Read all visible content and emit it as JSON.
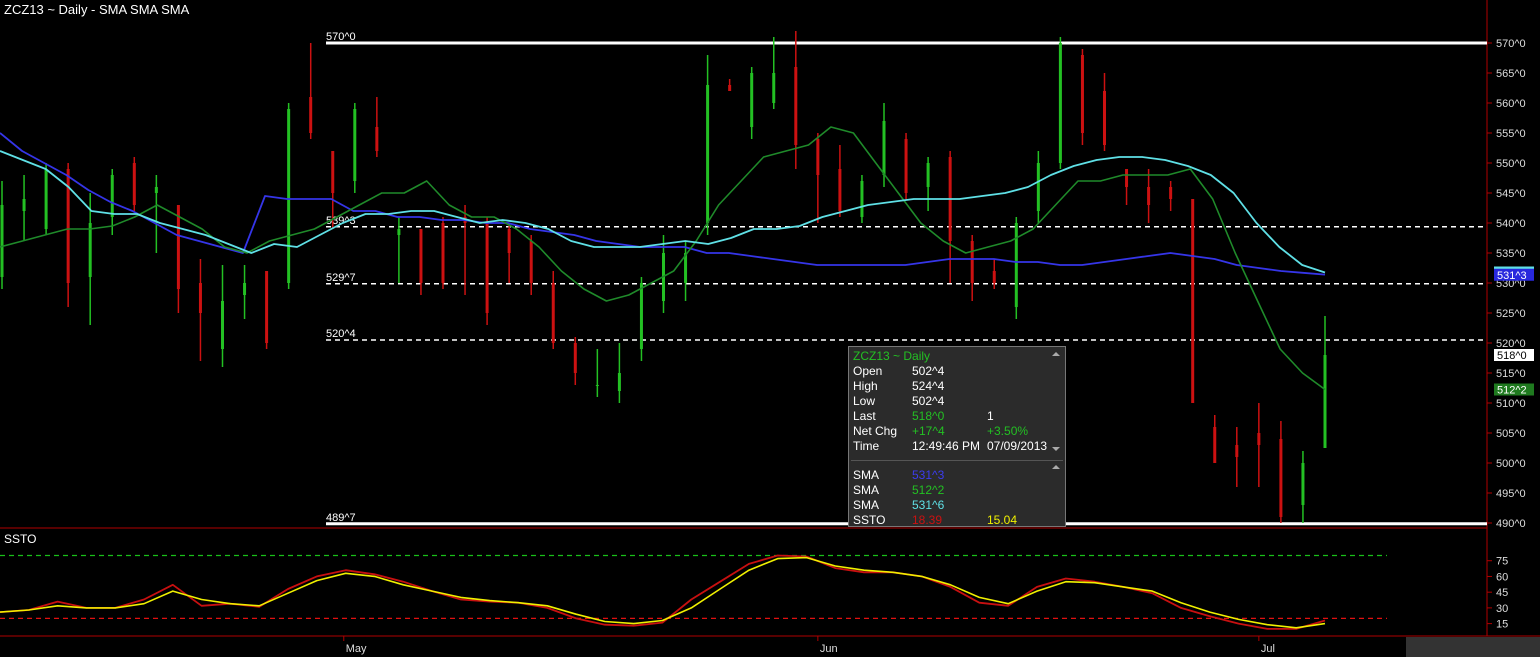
{
  "header": {
    "title": "ZCZ13 ~ Daily  -  SMA SMA SMA"
  },
  "indicator": {
    "title": "SSTO"
  },
  "levels": [
    {
      "label": "570^0",
      "value": 570.0,
      "style": "solid"
    },
    {
      "label": "539^3",
      "value": 539.375,
      "style": "dashed"
    },
    {
      "label": "529^7",
      "value": 529.875,
      "style": "dashed"
    },
    {
      "label": "520^4",
      "value": 520.5,
      "style": "dashed"
    },
    {
      "label": "489^7",
      "value": 489.875,
      "style": "solid"
    }
  ],
  "price_axis": {
    "ticks": [
      {
        "value": 570,
        "label": "570^0"
      },
      {
        "value": 565,
        "label": "565^0"
      },
      {
        "value": 560,
        "label": "560^0"
      },
      {
        "value": 555,
        "label": "555^0"
      },
      {
        "value": 550,
        "label": "550^0"
      },
      {
        "value": 545,
        "label": "545^0"
      },
      {
        "value": 540,
        "label": "540^0"
      },
      {
        "value": 535,
        "label": "535^0"
      },
      {
        "value": 530,
        "label": "530^0"
      },
      {
        "value": 525,
        "label": "525^0"
      },
      {
        "value": 520,
        "label": "520^0"
      },
      {
        "value": 515,
        "label": "515^0"
      },
      {
        "value": 510,
        "label": "510^0"
      },
      {
        "value": 505,
        "label": "505^0"
      },
      {
        "value": 500,
        "label": "500^0"
      },
      {
        "value": 495,
        "label": "495^0"
      },
      {
        "value": 490,
        "label": "490^0"
      }
    ],
    "badges": [
      {
        "value": 531.75,
        "label": "531^6",
        "color": "#5fe0e6",
        "text_color": "#000"
      },
      {
        "value": 531.375,
        "label": "531^3",
        "color": "#2828dd",
        "text_color": "#fff"
      },
      {
        "value": 518.0,
        "label": "518^0",
        "color": "#ffffff",
        "text_color": "#000"
      },
      {
        "value": 512.25,
        "label": "512^2",
        "color": "#1f7a1f",
        "text_color": "#fff"
      }
    ]
  },
  "osc_axis": {
    "ticks": [
      {
        "value": 75,
        "label": "75"
      },
      {
        "value": 60,
        "label": "60"
      },
      {
        "value": 45,
        "label": "45"
      },
      {
        "value": 30,
        "label": "30"
      },
      {
        "value": 15,
        "label": "15"
      }
    ]
  },
  "x_axis": {
    "labels": [
      {
        "index": 15.5,
        "label": "May"
      },
      {
        "index": 37,
        "label": "Jun"
      },
      {
        "index": 57,
        "label": "Jul"
      }
    ]
  },
  "tooltip": {
    "title": "ZCZ13 ~ Daily",
    "rows": [
      {
        "label": "Open",
        "v1": "502^4",
        "v2": "",
        "c1": "#ffffff",
        "c2": "#ffffff"
      },
      {
        "label": "High",
        "v1": "524^4",
        "v2": "",
        "c1": "#ffffff",
        "c2": "#ffffff"
      },
      {
        "label": "Low",
        "v1": "502^4",
        "v2": "",
        "c1": "#ffffff",
        "c2": "#ffffff"
      },
      {
        "label": "Last",
        "v1": "518^0",
        "v2": "1",
        "c1": "#23c023",
        "c2": "#ffffff"
      },
      {
        "label": "Net Chg",
        "v1": "+17^4",
        "v2": "+3.50%",
        "c1": "#23c023",
        "c2": "#23c023"
      },
      {
        "label": "Time",
        "v1": "12:49:46 PM",
        "v2": "07/09/2013",
        "c1": "#ffffff",
        "c2": "#ffffff"
      }
    ],
    "study_rows": [
      {
        "label": "SMA",
        "v1": "531^3",
        "v2": "",
        "c1": "#3c3cf0",
        "c2": "#fff"
      },
      {
        "label": "SMA",
        "v1": "512^2",
        "v2": "",
        "c1": "#23c023",
        "c2": "#fff"
      },
      {
        "label": "SMA",
        "v1": "531^6",
        "v2": "",
        "c1": "#5fe0e6",
        "c2": "#fff"
      },
      {
        "label": "SSTO",
        "v1": "18.39",
        "v2": "15.04",
        "c1": "#cc1111",
        "c2": "#f0f000"
      }
    ]
  },
  "colors": {
    "up": "#23c023",
    "down": "#cc1111",
    "sma_blue": "#3535e8",
    "sma_cyan": "#5fe0e6",
    "sma_green": "#1f8a2a",
    "ssto_k": "#c81010",
    "ssto_d": "#f0f000",
    "axis": "#b00000",
    "osc_upper": "#19c019",
    "osc_lower": "#e01010"
  },
  "chart_data": {
    "type": "candlestick",
    "title": "ZCZ13 ~ Daily",
    "price_range": [
      488,
      573.5
    ],
    "osc_range": [
      7,
      90
    ],
    "osc_levels": [
      80,
      20
    ],
    "candles": [
      {
        "o": 531,
        "h": 547,
        "l": 529,
        "c": 543
      },
      {
        "o": 542,
        "h": 548,
        "l": 537,
        "c": 544
      },
      {
        "o": 539,
        "h": 550,
        "l": 538,
        "c": 549
      },
      {
        "o": 549,
        "h": 550,
        "l": 526,
        "c": 530
      },
      {
        "o": 531,
        "h": 545,
        "l": 523,
        "c": 540
      },
      {
        "o": 541,
        "h": 549,
        "l": 538,
        "c": 548
      },
      {
        "o": 550,
        "h": 551,
        "l": 542,
        "c": 543
      },
      {
        "o": 545,
        "h": 548,
        "l": 535,
        "c": 546
      },
      {
        "o": 543,
        "h": 541,
        "l": 525,
        "c": 529
      },
      {
        "o": 530,
        "h": 534,
        "l": 517,
        "c": 525
      },
      {
        "o": 519,
        "h": 533,
        "l": 516,
        "c": 527
      },
      {
        "o": 528,
        "h": 533,
        "l": 524,
        "c": 530
      },
      {
        "o": 532,
        "h": 529,
        "l": 519,
        "c": 520
      },
      {
        "o": 530,
        "h": 560,
        "l": 529,
        "c": 559
      },
      {
        "o": 561,
        "h": 570,
        "l": 554,
        "c": 555
      },
      {
        "o": 552,
        "h": 552,
        "l": 539,
        "c": 545
      },
      {
        "o": 547,
        "h": 560,
        "l": 545,
        "c": 559
      },
      {
        "o": 556,
        "h": 561,
        "l": 551,
        "c": 552
      },
      {
        "o": 538,
        "h": 541,
        "l": 530,
        "c": 539
      },
      {
        "o": 539,
        "h": 539,
        "l": 528,
        "c": 530
      },
      {
        "o": 540,
        "h": 541,
        "l": 529,
        "c": 530
      },
      {
        "o": 541,
        "h": 543,
        "l": 528,
        "c": 540
      },
      {
        "o": 540,
        "h": 541,
        "l": 523,
        "c": 525
      },
      {
        "o": 539,
        "h": 540,
        "l": 530,
        "c": 535
      },
      {
        "o": 537,
        "h": 538,
        "l": 528,
        "c": 530
      },
      {
        "o": 530,
        "h": 532,
        "l": 519,
        "c": 520
      },
      {
        "o": 520,
        "h": 521,
        "l": 513,
        "c": 515
      },
      {
        "o": 513,
        "h": 519,
        "l": 511,
        "c": 513
      },
      {
        "o": 512,
        "h": 520,
        "l": 510,
        "c": 515
      },
      {
        "o": 519,
        "h": 531,
        "l": 517,
        "c": 530
      },
      {
        "o": 527,
        "h": 538,
        "l": 525,
        "c": 535
      },
      {
        "o": 530,
        "h": 537,
        "l": 527,
        "c": 535
      },
      {
        "o": 540,
        "h": 568,
        "l": 538,
        "c": 563
      },
      {
        "o": 563,
        "h": 564,
        "l": 562,
        "c": 562
      },
      {
        "o": 556,
        "h": 566,
        "l": 554,
        "c": 565
      },
      {
        "o": 560,
        "h": 571,
        "l": 559,
        "c": 565
      },
      {
        "o": 566,
        "h": 572,
        "l": 549,
        "c": 553
      },
      {
        "o": 554,
        "h": 555,
        "l": 540,
        "c": 548
      },
      {
        "o": 549,
        "h": 553,
        "l": 541,
        "c": 542
      },
      {
        "o": 541,
        "h": 548,
        "l": 540,
        "c": 547
      },
      {
        "o": 548,
        "h": 560,
        "l": 546,
        "c": 557
      },
      {
        "o": 554,
        "h": 555,
        "l": 544,
        "c": 545
      },
      {
        "o": 546,
        "h": 551,
        "l": 542,
        "c": 550
      },
      {
        "o": 551,
        "h": 552,
        "l": 530,
        "c": 537
      },
      {
        "o": 537,
        "h": 538,
        "l": 527,
        "c": 530
      },
      {
        "o": 532,
        "h": 534,
        "l": 529,
        "c": 530
      },
      {
        "o": 526,
        "h": 541,
        "l": 524,
        "c": 540
      },
      {
        "o": 542,
        "h": 552,
        "l": 540,
        "c": 550
      },
      {
        "o": 550,
        "h": 571,
        "l": 549,
        "c": 570
      },
      {
        "o": 568,
        "h": 569,
        "l": 553,
        "c": 555
      },
      {
        "o": 562,
        "h": 565,
        "l": 552,
        "c": 553
      },
      {
        "o": 549,
        "h": 549,
        "l": 543,
        "c": 546
      },
      {
        "o": 546,
        "h": 549,
        "l": 540,
        "c": 543
      },
      {
        "o": 546,
        "h": 547,
        "l": 542,
        "c": 544
      },
      {
        "o": 544,
        "h": 544,
        "l": 510,
        "c": 510
      },
      {
        "o": 506,
        "h": 508,
        "l": 500,
        "c": 500
      },
      {
        "o": 503,
        "h": 506,
        "l": 496,
        "c": 501
      },
      {
        "o": 505,
        "h": 510,
        "l": 496,
        "c": 503
      },
      {
        "o": 504,
        "h": 507,
        "l": 490,
        "c": 491
      },
      {
        "o": 493,
        "h": 502,
        "l": 490,
        "c": 500
      },
      {
        "o": 502.5,
        "h": 524.5,
        "l": 502.5,
        "c": 518
      }
    ],
    "sma_blue": [
      555,
      552,
      550,
      548,
      545.5,
      543.5,
      542,
      540,
      538,
      537,
      536,
      535,
      544.5,
      544,
      544,
      544,
      542,
      542,
      541,
      541,
      540.5,
      540.5,
      540,
      540,
      539,
      538.5,
      538,
      537,
      536.5,
      536,
      536,
      536,
      535,
      535,
      534.5,
      534,
      533.5,
      533,
      533,
      533,
      533,
      533,
      533.5,
      534,
      534,
      534,
      533.5,
      533.5,
      533,
      533,
      533.5,
      534,
      534.5,
      535,
      534.5,
      534,
      533,
      532.5,
      532,
      531.7,
      531.4
    ],
    "sma_cyan": [
      552,
      550.5,
      549,
      546,
      542,
      541.5,
      541.5,
      540,
      539,
      538,
      536.5,
      535,
      536.5,
      536,
      538,
      540,
      541.5,
      541.5,
      542,
      542,
      541,
      540,
      540.5,
      540,
      539,
      537,
      536,
      536,
      536,
      536.5,
      537,
      536.5,
      537.5,
      539,
      539,
      539.5,
      541,
      542,
      543,
      543.5,
      544,
      544,
      544,
      544.5,
      545,
      546,
      548,
      549.5,
      550.5,
      551,
      551,
      550.5,
      549.5,
      548,
      545,
      540,
      536,
      533,
      531.75
    ],
    "sma_green": [
      536,
      537,
      538,
      539,
      539,
      539.5,
      541,
      543,
      541,
      539,
      536,
      535,
      537,
      538,
      539,
      541,
      543,
      545,
      545,
      547,
      543,
      541,
      541,
      539,
      536,
      532,
      529,
      527,
      528,
      530,
      532,
      537,
      543,
      547,
      551,
      552,
      553,
      556,
      555,
      550,
      545,
      540,
      537,
      535,
      536,
      537,
      539,
      543,
      547,
      547,
      548,
      548,
      548,
      549,
      544,
      535,
      527,
      519,
      515,
      512.25
    ],
    "ssto_k": [
      26,
      28,
      36,
      30,
      30,
      38,
      52,
      32,
      34,
      31,
      48,
      60,
      66,
      62,
      55,
      46,
      38,
      36,
      35,
      30,
      20,
      14,
      13,
      16,
      38,
      55,
      72,
      80,
      79,
      68,
      64,
      64,
      60,
      50,
      35,
      32,
      50,
      58,
      55,
      50,
      44,
      30,
      22,
      15,
      10,
      10,
      18
    ],
    "ssto_d": [
      26,
      28,
      32,
      30,
      30,
      34,
      46,
      38,
      34,
      32,
      44,
      56,
      63,
      60,
      52,
      46,
      40,
      37,
      35,
      32,
      24,
      17,
      15,
      18,
      30,
      48,
      66,
      77,
      78,
      70,
      66,
      64,
      60,
      52,
      40,
      34,
      46,
      55,
      54,
      50,
      46,
      35,
      26,
      19,
      14,
      11,
      15
    ]
  }
}
